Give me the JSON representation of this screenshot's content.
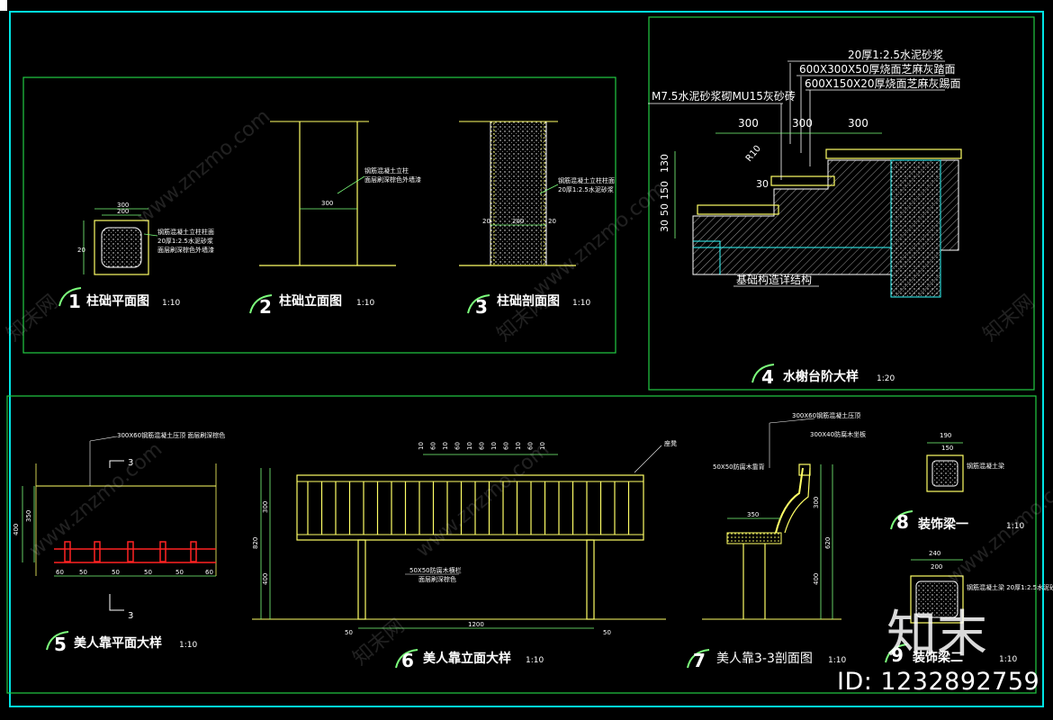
{
  "colors": {
    "frame": "#00e5e5",
    "border": "#22cc44",
    "line": "#ffff66",
    "white": "#ffffff",
    "green": "#7dff7d",
    "red": "#ff2222",
    "cyan": "#33ffff"
  },
  "detail1": {
    "num": "1",
    "title": "柱础平面图",
    "scale": "1:10",
    "dims": [
      "300",
      "200",
      "20"
    ],
    "note1": "钢筋混凝土立柱柱面",
    "note2": "20厚1:2.5水泥砂浆",
    "note3": "面层刷深棕色外墙漆"
  },
  "detail2": {
    "num": "2",
    "title": "柱础立面图",
    "scale": "1:10",
    "dim": "300",
    "note1": "钢筋混凝土立柱",
    "note2": "面层刷深棕色外墙漆"
  },
  "detail3": {
    "num": "3",
    "title": "柱础剖面图",
    "scale": "1:10",
    "dims": [
      "20",
      "200",
      "20"
    ],
    "note1": "钢筋混凝土立柱柱面",
    "note2": "20厚1:2.5水泥砂浆"
  },
  "detail4": {
    "num": "4",
    "title": "水榭台阶大样",
    "scale": "1:20",
    "labels": [
      "20厚1:2.5水泥砂浆",
      "600X300X50厚烧面芝麻灰踏面",
      "600X150X20厚烧面芝麻灰踢面",
      "M7.5水泥砂浆砌MU15灰砂砖",
      "基础构造详结构"
    ],
    "dims": [
      "300",
      "300",
      "300",
      "130",
      "150",
      "50",
      "30",
      "R10",
      "30"
    ]
  },
  "detail5": {
    "num": "5",
    "title": "美人靠平面大样",
    "scale": "1:10",
    "sec": "3",
    "note": "300X60钢筋混凝土压顶 面层刷深棕色",
    "dims": [
      "60",
      "140",
      "50",
      "140",
      "50",
      "140",
      "50",
      "140",
      "50",
      "140",
      "60"
    ],
    "vdims": [
      "400",
      "350",
      "50",
      "50",
      "40"
    ]
  },
  "detail6": {
    "num": "6",
    "title": "美人靠立面大样",
    "scale": "1:10",
    "total": "1200",
    "side": "50",
    "vdims": [
      "820",
      "50",
      "300",
      "50",
      "400"
    ],
    "tops": [
      "10",
      "60",
      "10",
      "60",
      "10",
      "60",
      "10",
      "60",
      "10",
      "60",
      "10"
    ],
    "note1": "50X50防腐木横栏",
    "note2": "面层刷深棕色",
    "label": "座凳"
  },
  "detail7": {
    "num": "7",
    "title": "美人靠3-3剖面图",
    "scale": "1:10",
    "dims": [
      "350",
      "50",
      "300",
      "50",
      "400",
      "620",
      "50"
    ],
    "note1": "300X60钢筋混凝土压顶",
    "note2": "300X40防腐木坐板",
    "note3": "50X50防腐木靠背"
  },
  "detail8": {
    "num": "8",
    "title": "装饰梁一",
    "scale": "1:10",
    "dims": [
      "190",
      "150",
      "20",
      "20"
    ],
    "note": "钢筋混凝土梁"
  },
  "detail9": {
    "num": "9",
    "title": "装饰梁二",
    "scale": "1:10",
    "dims": [
      "240",
      "200",
      "20",
      "20"
    ],
    "note": "钢筋混凝土梁 20厚1:2.5水泥砂浆"
  },
  "watermark": {
    "site": "www.znzmo.com",
    "brand": "知末网",
    "logo": "知末",
    "id": "ID: 1232892759"
  }
}
